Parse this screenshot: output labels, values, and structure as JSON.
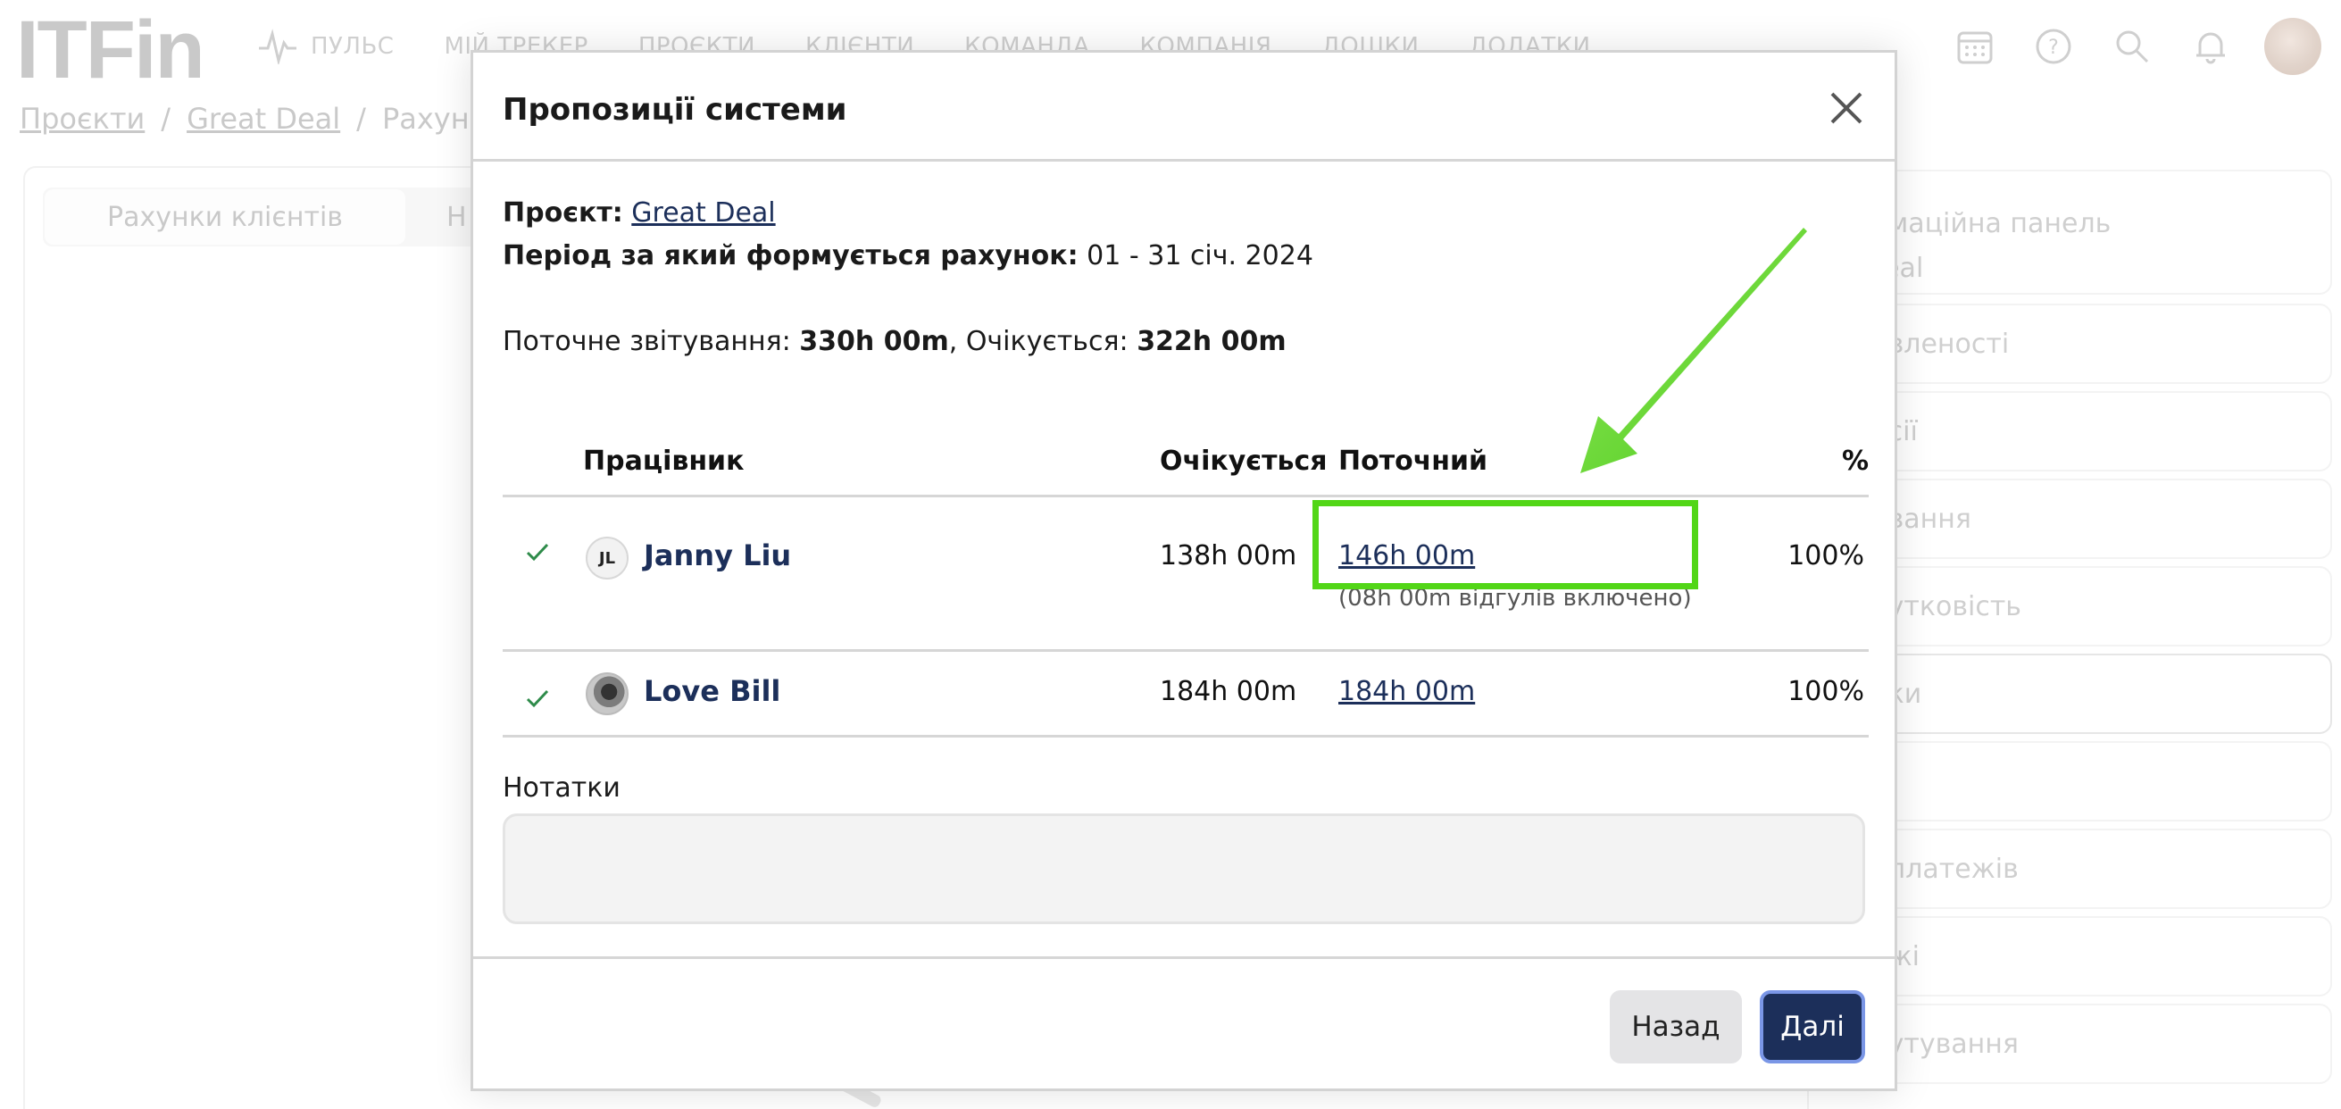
{
  "app": {
    "logo": "ITFin",
    "nav": [
      "ПУЛЬС",
      "МІЙ ТРЕКЕР",
      "ПРОЄКТИ",
      "КЛІЄНТИ",
      "КОМАНДА",
      "КОМПАНІЯ",
      "ДОШКИ",
      "ДОДАТКИ"
    ],
    "breadcrumb": [
      "Проєкти",
      "/",
      "Great Deal",
      "/",
      "Рахунки"
    ],
    "tabs": [
      "Рахунки клієнтів",
      "Н"
    ],
    "right_panel": [
      "...маційна панель",
      "Deal",
      "...вленості",
      "...сії",
      "...вання",
      "...утковість",
      "...ки",
      "",
      "...платежів",
      "...жі",
      "...утування"
    ]
  },
  "modal": {
    "title": "Пропозиції системи",
    "project_label": "Проєкт:",
    "project_name": "Great Deal",
    "period_label": "Період за який формується рахунок:",
    "period_value": "01 - 31 січ. 2024",
    "current_label": "Поточне звітування:",
    "current_value": "330h 00m",
    "expected_label": "Очікується:",
    "expected_value": "322h 00m",
    "table": {
      "headers": {
        "employee": "Працівник",
        "expected": "Очікується",
        "current": "Поточний",
        "percent": "%"
      },
      "rows": [
        {
          "initials": "JL",
          "name": "Janny Liu",
          "expected": "138h 00m",
          "current": "146h 00m",
          "note": "(08h 00m відгулів включено)",
          "percent": "100%"
        },
        {
          "initials": "",
          "name": "Love Bill",
          "expected": "184h 00m",
          "current": "184h 00m",
          "note": "",
          "percent": "100%"
        }
      ]
    },
    "notes_label": "Нотатки",
    "notes_value": "",
    "back_button": "Назад",
    "next_button": "Далі"
  },
  "colors": {
    "accent_dark": "#1c2f5a",
    "highlight_green": "#52d617",
    "check_green": "#2e8b4a"
  }
}
